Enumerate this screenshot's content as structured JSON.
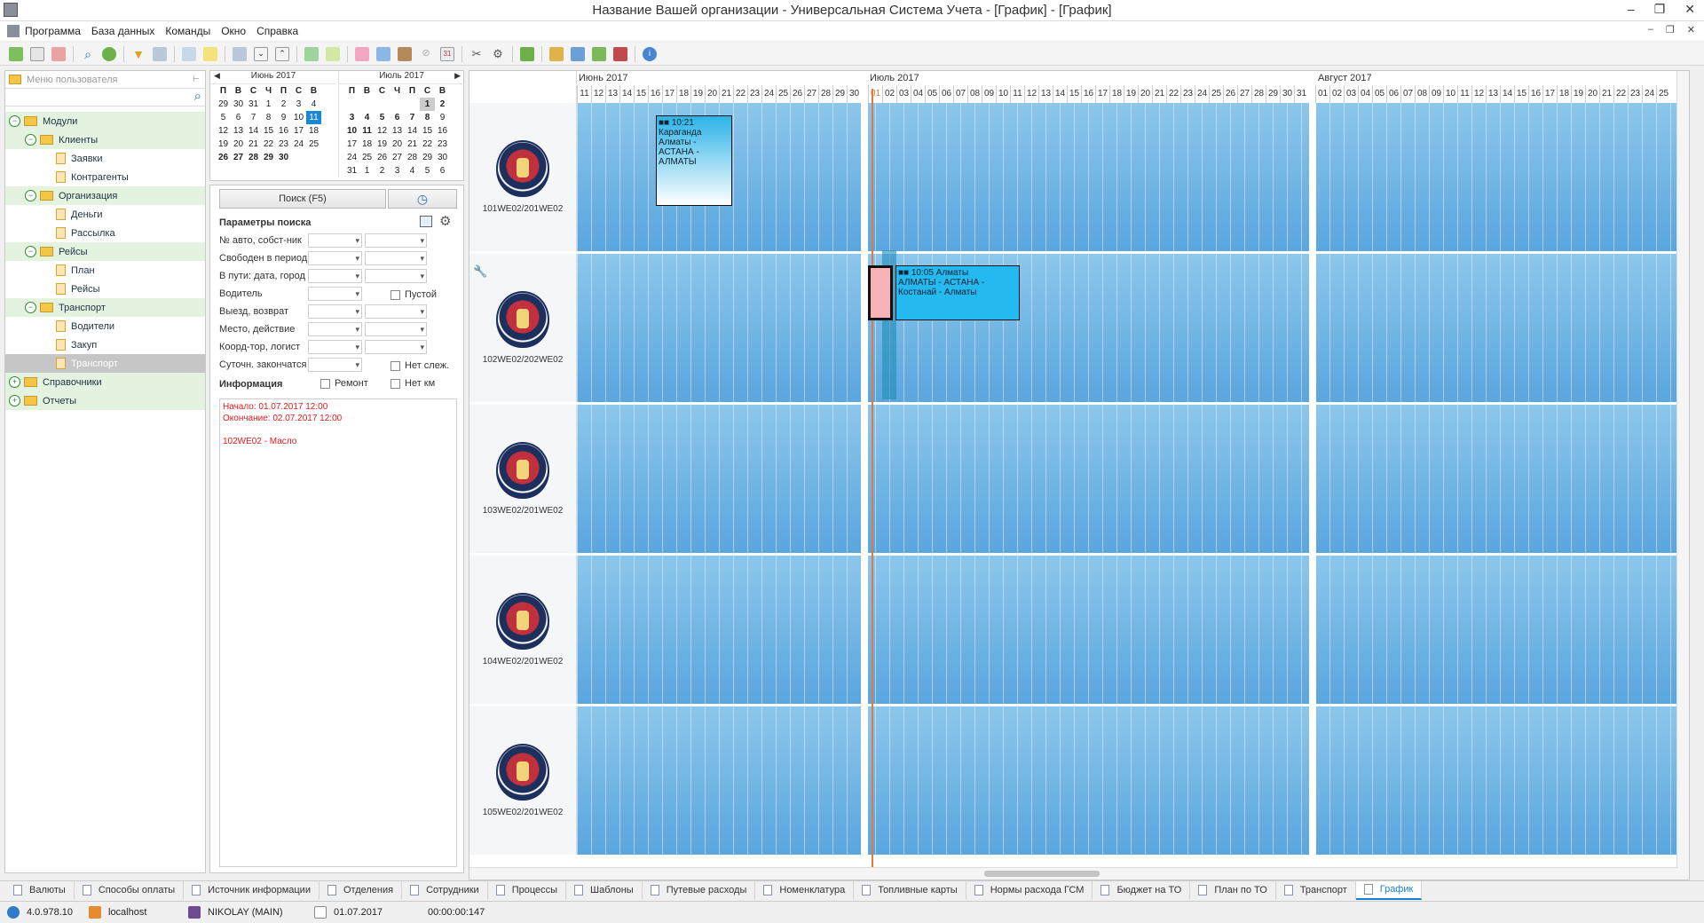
{
  "window": {
    "title": "Название Вашей организации - Универсальная Система Учета - [График] - [График]",
    "controls": [
      "–",
      "❐",
      "✕"
    ]
  },
  "menu": [
    "Программа",
    "База данных",
    "Команды",
    "Окно",
    "Справка"
  ],
  "mdi_controls": [
    "–",
    "❐",
    "✕"
  ],
  "left_panel": {
    "placeholder": "Меню пользователя",
    "tree": [
      {
        "label": "Модули",
        "level": 0,
        "type": "folder",
        "exp": "−"
      },
      {
        "label": "Клиенты",
        "level": 1,
        "type": "folder",
        "exp": "−"
      },
      {
        "label": "Заявки",
        "level": 2,
        "type": "doc"
      },
      {
        "label": "Контрагенты",
        "level": 2,
        "type": "doc"
      },
      {
        "label": "Организация",
        "level": 1,
        "type": "folder",
        "exp": "−"
      },
      {
        "label": "Деньги",
        "level": 2,
        "type": "doc"
      },
      {
        "label": "Рассылка",
        "level": 2,
        "type": "doc"
      },
      {
        "label": "Рейсы",
        "level": 1,
        "type": "folder",
        "exp": "−"
      },
      {
        "label": "План",
        "level": 2,
        "type": "doc"
      },
      {
        "label": "Рейсы",
        "level": 2,
        "type": "doc"
      },
      {
        "label": "Транспорт",
        "level": 1,
        "type": "folder",
        "exp": "−"
      },
      {
        "label": "Водители",
        "level": 2,
        "type": "doc"
      },
      {
        "label": "Закуп",
        "level": 2,
        "type": "doc"
      },
      {
        "label": "Транспорт",
        "level": 2,
        "type": "doc",
        "selected": true
      },
      {
        "label": "Справочники",
        "level": 0,
        "type": "folder",
        "exp": "+"
      },
      {
        "label": "Отчеты",
        "level": 0,
        "type": "folder",
        "exp": "+"
      }
    ]
  },
  "calendars": [
    {
      "title": "Июнь 2017",
      "weekdays": [
        "П",
        "В",
        "С",
        "Ч",
        "П",
        "С",
        "В"
      ],
      "days": [
        "29",
        "30",
        "31",
        "1",
        "2",
        "3",
        "4",
        "5",
        "6",
        "7",
        "8",
        "9",
        "10",
        "11",
        "12",
        "13",
        "14",
        "15",
        "16",
        "17",
        "18",
        "19",
        "20",
        "21",
        "22",
        "23",
        "24",
        "25",
        "26",
        "27",
        "28",
        "29",
        "30",
        "",
        ""
      ]
    },
    {
      "title": "Июль 2017",
      "weekdays": [
        "П",
        "В",
        "С",
        "Ч",
        "П",
        "С",
        "В"
      ],
      "days": [
        "",
        "",
        "",
        "",
        "",
        "1",
        "2",
        "3",
        "4",
        "5",
        "6",
        "7",
        "8",
        "9",
        "10",
        "11",
        "12",
        "13",
        "14",
        "15",
        "16",
        "17",
        "18",
        "19",
        "20",
        "21",
        "22",
        "23",
        "24",
        "25",
        "26",
        "27",
        "28",
        "29",
        "30",
        "31",
        "1",
        "2",
        "3",
        "4",
        "5",
        "6"
      ]
    }
  ],
  "search": {
    "button": "Поиск (F5)",
    "params_title": "Параметры поиска",
    "fields": [
      "№ авто, собст-ник",
      "Свободен в период",
      "В пути: дата, город",
      "Водитель",
      "Выезд, возврат",
      "Место, действие",
      "Коорд-тор, логист",
      "Суточн. закончатся"
    ],
    "cb_empty": "Пустой",
    "cb_notrack": "Нет слеж.",
    "cb_repair": "Ремонт",
    "cb_nokm": "Нет км",
    "info_title": "Информация",
    "info_lines": [
      "Начало: 01.07.2017 12:00",
      "Окончание: 02.07.2017 12:00",
      "",
      "102WE02 - Масло"
    ]
  },
  "schedule": {
    "months": [
      "Июнь 2017",
      "Июль 2017",
      "Август 2017"
    ],
    "june_days": [
      "11",
      "12",
      "13",
      "14",
      "15",
      "16",
      "17",
      "18",
      "19",
      "20",
      "21",
      "22",
      "23",
      "24",
      "25",
      "26",
      "27",
      "28",
      "29",
      "30"
    ],
    "july_days": [
      "01",
      "02",
      "03",
      "04",
      "05",
      "06",
      "07",
      "08",
      "09",
      "10",
      "11",
      "12",
      "13",
      "14",
      "15",
      "16",
      "17",
      "18",
      "19",
      "20",
      "21",
      "22",
      "23",
      "24",
      "25",
      "26",
      "27",
      "28",
      "29",
      "30",
      "31"
    ],
    "aug_days": [
      "01",
      "02",
      "03",
      "04",
      "05",
      "06",
      "07",
      "08",
      "09",
      "10",
      "11",
      "12",
      "13",
      "14",
      "15",
      "16",
      "17",
      "18",
      "19",
      "20",
      "21",
      "22",
      "23",
      "24",
      "25"
    ],
    "trucks": [
      "101WE02/201WE02",
      "102WE02/202WE02",
      "103WE02/201WE02",
      "104WE02/201WE02",
      "105WE02/201WE02"
    ],
    "events": [
      {
        "time": "10:21",
        "text": "Караганда Алматы - АСТАНА - АЛМАТЫ"
      },
      {
        "time": "10:05 Алматы",
        "text": "АЛМАТЫ - АСТАНА - Костанай - Алматы"
      }
    ]
  },
  "tabs": [
    "Валюты",
    "Способы оплаты",
    "Источник информации",
    "Отделения",
    "Сотрудники",
    "Процессы",
    "Шаблоны",
    "Путевые расходы",
    "Номенклатура",
    "Топливные карты",
    "Нормы расхода ГСМ",
    "Бюджет на ТО",
    "План по ТО",
    "Транспорт",
    "График"
  ],
  "status": {
    "version": "4.0.978.10",
    "server": "localhost",
    "user": "NIKOLAY (MAIN)",
    "date": "01.07.2017",
    "timer": "00:00:00:147"
  }
}
